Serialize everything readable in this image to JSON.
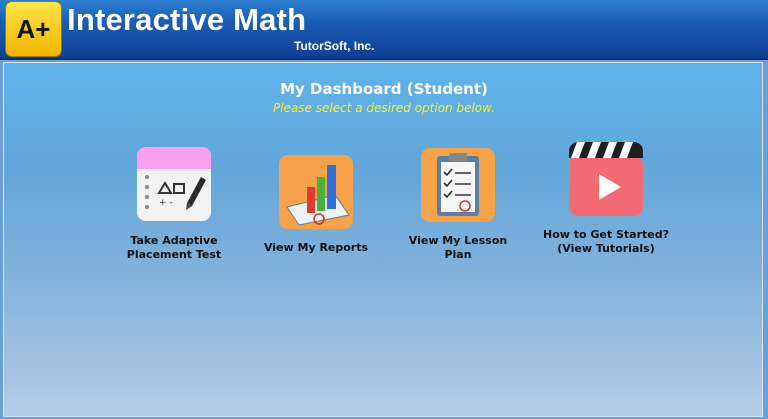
{
  "header": {
    "logo_text": "A+",
    "app_title": "Interactive Math",
    "company": "TutorSoft, Inc."
  },
  "dashboard": {
    "title": "My Dashboard (Student)",
    "subtitle": "Please select a desired option below."
  },
  "options": [
    {
      "label_line1": "Take Adaptive",
      "label_line2": "Placement Test",
      "icon": "placement-test-icon"
    },
    {
      "label_line1": "View My Reports",
      "label_line2": "",
      "icon": "reports-chart-icon"
    },
    {
      "label_line1": "View My Lesson",
      "label_line2": "Plan",
      "icon": "lesson-plan-clipboard-icon"
    },
    {
      "label_line1": "How to Get Started?",
      "label_line2": "(View Tutorials)",
      "icon": "video-tutorial-icon"
    }
  ],
  "colors": {
    "header_blue": "#1b5fb6",
    "subtitle_yellow": "#f5f03a",
    "tile_orange": "#f6a24a",
    "tile_pink": "#f26b73"
  }
}
